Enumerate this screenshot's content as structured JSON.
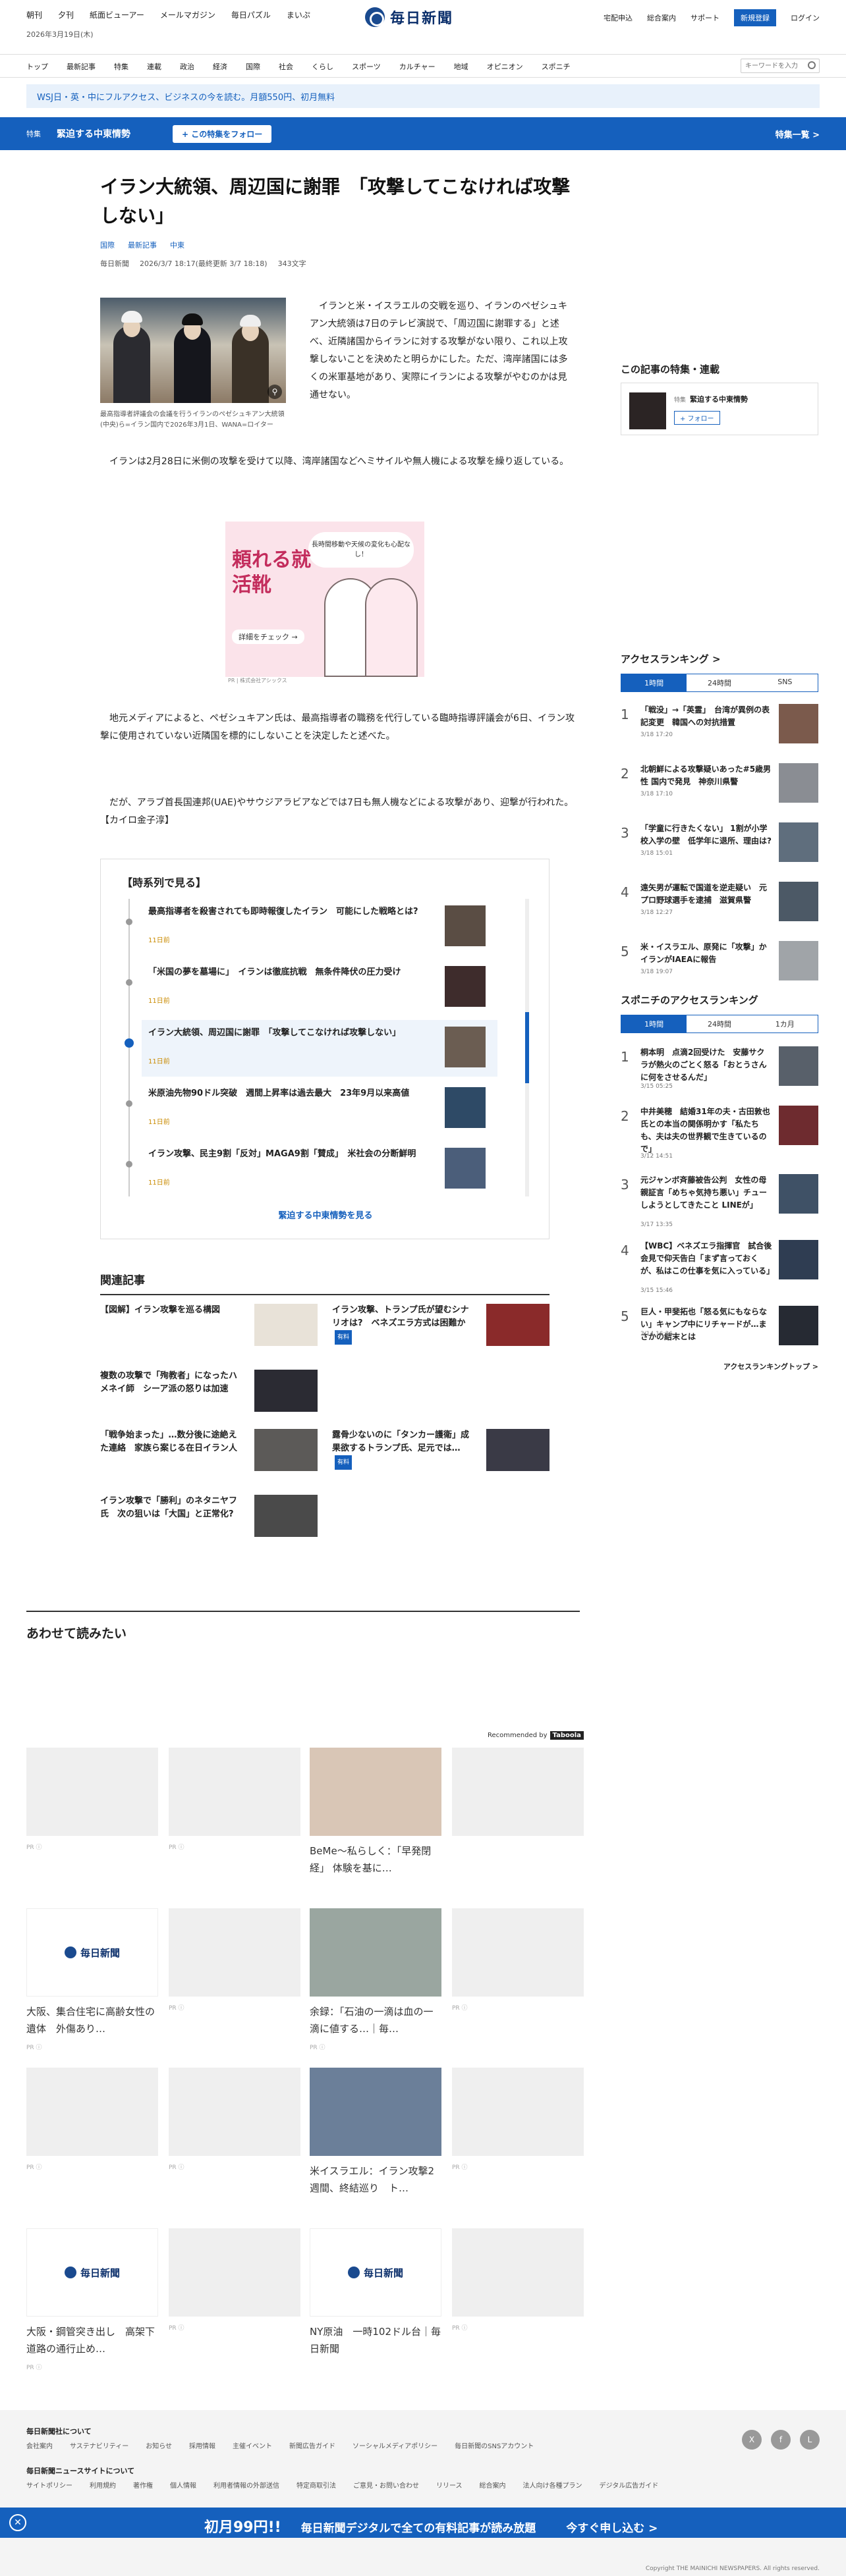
{
  "topnav": [
    "朝刊",
    "夕刊",
    "紙面ビューアー",
    "メールマガジン",
    "毎日パズル",
    "まいぷ"
  ],
  "date": "2026年3月19日(木)",
  "brand": "毎日新聞",
  "rightnav": {
    "delivery": "宅配申込",
    "customer": "総合案内",
    "support": "サポート",
    "register": "新規登録",
    "login": "ログイン"
  },
  "mainnav": [
    "トップ",
    "最新記事",
    "特集",
    "連載",
    "政治",
    "経済",
    "国際",
    "社会",
    "くらし",
    "スポーツ",
    "カルチャー",
    "地域",
    "オピニオン",
    "スポニチ"
  ],
  "search": {
    "placeholder": "キーワードを入力"
  },
  "promo": "WSJ日・英・中にフルアクセス、ビジネスの今を読む。月額550円、初月無料",
  "feature": {
    "label": "特集",
    "title": "緊迫する中東情勢",
    "follow": "+ この特集をフォロー",
    "all": "特集一覧 >"
  },
  "article": {
    "headline": "イラン大統領、周辺国に謝罪　「攻撃してこなければ攻撃しない」",
    "tags": [
      "国際",
      "最新記事",
      "中東"
    ],
    "meta": {
      "source": "毎日新聞",
      "time": "2026/3/7 18:17(最終更新 3/7 18:18)",
      "chars": "343文字"
    },
    "caption": "最高指導者評議会の会議を行うイランのペゼシュキアン大統領(中央)ら=イラン国内で2026年3月1日、WANA=ロイター",
    "p1": "　イランと米・イスラエルの交戦を巡り、イランのペゼシュキアン大統領は7日のテレビ演説で、「周辺国に謝罪する」と述べ、近隣諸国からイランに対する攻撃がない限り、これ以上攻撃しないことを決めたと明らかにした。ただ、湾岸諸国には多くの米軍基地があり、実際にイランによる攻撃がやむのかは見通せない。",
    "p2": "　イランは2月28日に米側の攻撃を受けて以降、湾岸諸国などへミサイルや無人機による攻撃を繰り返している。",
    "ad": {
      "t1": "頼れる就活靴",
      "check": "詳細をチェック →",
      "bubble": "長時間移動や天候の変化も心配なし！",
      "foot": "PR | 株式会社アシックス"
    },
    "p3": "　地元メディアによると、ペゼシュキアン氏は、最高指導者の職務を代行している臨時指導評議会が6日、イラン攻撃に使用されていない近隣国を標的にしないことを決定したと述べた。",
    "p4": "　だが、アラブ首長国連邦(UAE)やサウジアラビアなどでは7日も無人機などによる攻撃があり、迎撃が行われた。【カイロ金子淳】"
  },
  "timeline": {
    "title": "【時系列で見る】",
    "items": [
      {
        "text": "最高指導者を殺害されても即時報復したイラン　可能にした戦略とは?",
        "date": "11日前"
      },
      {
        "text": "「米国の夢を墓場に」　イランは徹底抗戦　無条件降伏の圧力受け",
        "date": "11日前"
      },
      {
        "text": "イラン大統領、周辺国に謝罪　「攻撃してこなければ攻撃しない」",
        "date": "11日前"
      },
      {
        "text": "米原油先物90ドル突破　週間上昇率は過去最大　23年9月以来高値",
        "date": "11日前"
      },
      {
        "text": "イラン攻撃、民主9割「反対」MAGA9割「賛成」　米社会の分断鮮明",
        "date": "11日前"
      }
    ],
    "more": "緊迫する中東情勢を見る"
  },
  "related": {
    "heading": "関連記事",
    "items": [
      {
        "text": "【図解】イラン攻撃を巡る構図"
      },
      {
        "text": "イラン攻撃、トランプ氏が望むシナリオは?　ベネズエラ方式は困難か",
        "badge": "有料"
      },
      {
        "text": "複数の攻撃で「殉教者」になったハメネイ師　シーア派の怒りは加速"
      },
      {
        "text": "「戦争始まった」…数分後に途絶えた連絡　家族ら案じる在日イラン人"
      },
      {
        "text": "露骨少ないのに「タンカー護衛」成果欲するトランプ氏、足元では…",
        "badge": "有料"
      },
      {
        "text": "イラン攻撃で「勝利」のネタニヤフ氏　次の狙いは「大国」と正常化?"
      }
    ]
  },
  "side": {
    "series_h": "この記事の特集・連載",
    "series": {
      "label": "特集",
      "title": "緊迫する中東情勢",
      "follow": "+ フォロー"
    },
    "rank_h": "アクセスランキング >",
    "rank_tabs": [
      "1時間",
      "24時間",
      "SNS"
    ],
    "ranking": [
      {
        "n": "1",
        "t": "「戦没」→「英霊」　台湾が異例の表記変更　韓国への対抗措置",
        "d": "3/18 17:20"
      },
      {
        "n": "2",
        "t": "北朝鮮による攻撃疑いあった#5歳男性 国内で発見　神奈川県警",
        "d": "3/18 17:10"
      },
      {
        "n": "3",
        "t": "「学童に行きたくない」 1割が小学校入学の壁　低学年に退所、理由は?",
        "d": "3/18 15:01"
      },
      {
        "n": "4",
        "t": "遠矢男が運転で国道を逆走疑い　元プロ野球選手を逮捕　滋賀県警",
        "d": "3/18 12:27"
      },
      {
        "n": "5",
        "t": "米・イスラエル、原発に「攻撃」か　イランがIAEAに報告",
        "d": "3/18 19:07"
      }
    ],
    "spo_h": "スポニチのアクセスランキング",
    "spo_tabs": [
      "1時間",
      "24時間",
      "1カ月"
    ],
    "spo": [
      {
        "n": "1",
        "t": "桐本明　点滴2回受けた　安藤サクラが熱火のごとく怒る「おとうさんに何をさせるんだ」",
        "d": "3/15 05:25"
      },
      {
        "n": "2",
        "t": "中井美穂　結婚31年の夫・古田敦也氏との本当の関係明かす「私たちも、夫は夫の世界観で生きているので」",
        "d": "3/12 14:51"
      },
      {
        "n": "3",
        "t": "元ジャンボ斉藤被告公判　女性の母親証言「めちゃ気持ち悪い」チューしようとしてきたこと LINEが」",
        "d": "3/17 13:35"
      },
      {
        "n": "4",
        "t": "【WBC】ベネズエラ指揮官　試合後会見で仰天告白「まず言っておくが、私はこの仕事を気に入っている」",
        "d": "3/15 15:46"
      },
      {
        "n": "5",
        "t": "巨人・甲斐拓也「怒る気にもならない」キャンプ中にリチャードが…まさかの結末とは",
        "d": "3/14 16:36"
      }
    ],
    "spo_more": "アクセスランキングトップ >"
  },
  "recommend": {
    "heading": "あわせて読みたい",
    "by": "Recommended by",
    "brand": "Taboola",
    "cards": [
      {
        "t": "",
        "pr": "PR ⓘ"
      },
      {
        "t": "",
        "pr": "PR ⓘ"
      },
      {
        "t": "BeMe〜私らしく：「早発閉経」 体験を基に…",
        "pr": ""
      },
      {
        "t": "",
        "pr": ""
      },
      {
        "t": "大阪、集合住宅に高齢女性の遺体　外傷あり…",
        "pr": "PR ⓘ"
      },
      {
        "t": "",
        "pr": "PR ⓘ"
      },
      {
        "t": "余録：「石油の一滴は血の一滴に値する…｜毎…",
        "pr": "PR ⓘ"
      },
      {
        "t": "",
        "pr": "PR ⓘ"
      },
      {
        "t": "",
        "pr": "PR ⓘ"
      },
      {
        "t": "",
        "pr": "PR ⓘ"
      },
      {
        "t": "米イスラエル：イラン攻撃2週間、終結巡り　ト…",
        "pr": ""
      },
      {
        "t": "",
        "pr": "PR ⓘ"
      },
      {
        "t": "大阪・鋼管突き出し　高架下道路の通行止め…",
        "pr": "PR ⓘ"
      },
      {
        "t": "",
        "pr": "PR ⓘ"
      },
      {
        "t": "NY原油　一時102ドル台｜毎日新聞",
        "pr": ""
      },
      {
        "t": "",
        "pr": "PR ⓘ"
      }
    ],
    "logo": "毎日新聞"
  },
  "footer": {
    "about_h": "毎日新聞社について",
    "about": [
      "会社案内",
      "サステナビリティー",
      "お知らせ",
      "採用情報",
      "主催イベント",
      "新聞広告ガイド",
      "ソーシャルメディアポリシー",
      "毎日新聞のSNSアカウント"
    ],
    "site_h": "毎日新聞ニュースサイトについて",
    "site": [
      "サイトポリシー",
      "利用規約",
      "著作権",
      "個人情報",
      "利用者情報の外部送信",
      "特定商取引法",
      "ご意見・お問い合わせ",
      "リリース",
      "総合案内",
      "法人向け各種プラン",
      "デジタル広告ガイド"
    ],
    "copy": "Copyright THE MAINICHI NEWSPAPERS. All rights reserved."
  },
  "sticky": {
    "price": "初月99円!!",
    "text": "毎日新聞デジタルで全ての有料記事が読み放題",
    "cta": "今すぐ申し込む >"
  }
}
